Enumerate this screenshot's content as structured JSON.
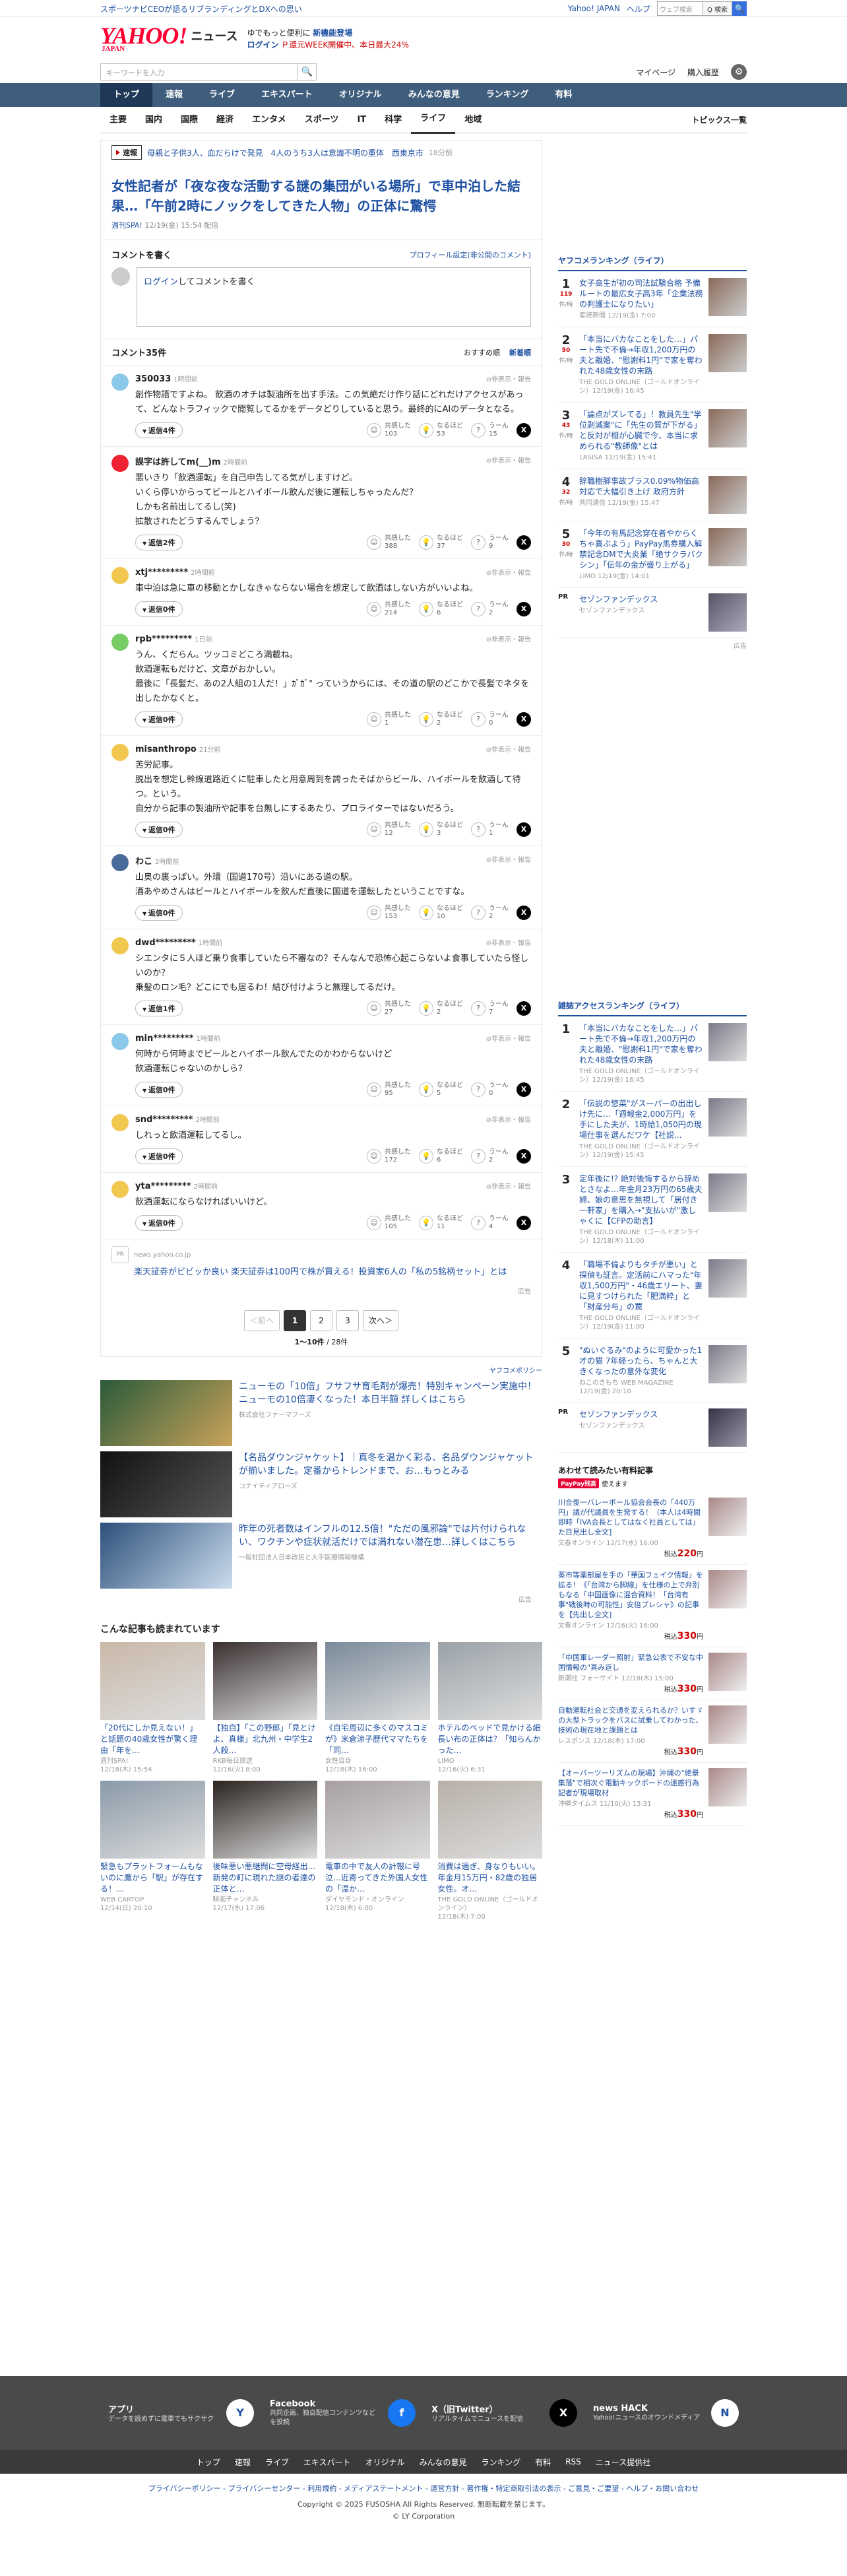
{
  "promo": {
    "text": "スポーツナビCEOが語るリブランディングとDXへの思い"
  },
  "toplinks": {
    "yahoo": "Yahoo! JAPAN",
    "help": "ヘルプ",
    "search_placeholder": "ウェブ検索",
    "search_btn": "Q 検索",
    "search_go": "🔍"
  },
  "header": {
    "logo": "YAHOO!",
    "logo_sub": "JAPAN",
    "title": "ニュース",
    "info1": "ゆでもっと便利に",
    "info1b": "新機能登場",
    "info2": "ログイン",
    "info3": "Ｐ還元WEEK開催中、本日最大24%"
  },
  "search": {
    "placeholder": "キーワードを入力",
    "btn": "🔍",
    "links": [
      "マイページ",
      "購入履歴"
    ],
    "gear": "⚙"
  },
  "gnav": [
    "トップ",
    "速報",
    "ライブ",
    "エキスパート",
    "オリジナル",
    "みんなの意見",
    "ランキング",
    "有料"
  ],
  "subnav": [
    "主要",
    "国内",
    "国際",
    "経済",
    "エンタメ",
    "スポーツ",
    "IT",
    "科学",
    "ライフ",
    "地域"
  ],
  "subnav_right": "トピックス一覧",
  "breaking": {
    "tag": "速報",
    "text": "母親と子供3人、血だらけで発見　4人のうち3人は意識不明の重体　西東京市",
    "time": "18分前"
  },
  "article": {
    "title": "女性記者が「夜な夜な活動する謎の集団がいる場所」で車中泊した結果…「午前2時にノックをしてきた人物」の正体に驚愕",
    "source": "週刊SPA!",
    "date": "12/19(金) 15:54 配信"
  },
  "write": {
    "head": "コメントを書く",
    "profile": "プロフィール設定(非公開のコメント)",
    "login": "ログイン",
    "placeholder": "してコメントを書く"
  },
  "comments_head": {
    "count": "コメント35件",
    "sort1": "おすすめ順",
    "sort2": "新着順"
  },
  "comments": [
    {
      "name": "350033",
      "time": "1時間前",
      "text": "創作物語ですよね。 飲酒のオチは製油所を出す手法。この気絶だけ作り話にどれだけアクセスがあって、どんなトラフィックで閲覧してるかをデータどりしていると思う。最終的にAIのデータとなる。",
      "reply": "返信4件",
      "r1": "共感した",
      "n1": "103",
      "r2": "なるほど",
      "n2": "53",
      "r3": "うーん",
      "n3": "15",
      "color": "#8cc8e8"
    },
    {
      "name": "誤字は許してm(__)m",
      "time": "2時間前",
      "text": "悪いきり「飲酒運転」を自己申告してる気がしますけど。\nいくら停いからってビールとハイボール飲んだ後に運転しちゃったんだ？\nしかも名前出してるし(笑)\n拡散されたどうするんでしょう？",
      "reply": "返信2件",
      "r1": "共感した",
      "n1": "388",
      "r2": "なるほど",
      "n2": "37",
      "r3": "うーん",
      "n3": "9",
      "color": "#e23"
    },
    {
      "name": "xtj*********",
      "time": "2時間前",
      "text": "車中泊は急に車の移動とかしなきゃならない場合を想定して飲酒はしない方がいいよね。",
      "reply": "返信0件",
      "r1": "共感した",
      "n1": "214",
      "r2": "なるほど",
      "n2": "6",
      "r3": "うーん",
      "n3": "2",
      "color": "#f0c850"
    },
    {
      "name": "rpb*********",
      "time": "1日前",
      "text": "うん、くだらん。ツッコミどころ満載ね。\n飲酒運転もだけど、文章がおかしい。\n最後に「長髪だ、あの2人組の1人だ！」ｶﾞｶﾞ\" っていうからには、その道の駅のどこかで長髪でネタを出したかなくと。",
      "reply": "返信0件",
      "r1": "共感した",
      "n1": "1",
      "r2": "なるほど",
      "n2": "2",
      "r3": "うーん",
      "n3": "0",
      "color": "#7c6"
    },
    {
      "name": "misanthropo",
      "time": "21分前",
      "text": "苦労記事。\n脱出を想定し幹線道路近くに駐車したと用意周到を誇ったそばからビール、ハイボールを飲酒して待つ。という。\n自分から記事の製油所や記事を台無しにするあたり、プロライターではないだろう。",
      "reply": "返信0件",
      "r1": "共感した",
      "n1": "12",
      "r2": "なるほど",
      "n2": "3",
      "r3": "うーん",
      "n3": "1",
      "color": "#f0c850"
    },
    {
      "name": "わこ",
      "time": "2時間前",
      "text": "山奥の裏っぱい。外環（国道170号）沿いにある道の駅。\n酒あやめさんはビールとハイボールを飲んだ直後に国道を運転したということですな。",
      "reply": "返信0件",
      "r1": "共感した",
      "n1": "153",
      "r2": "なるほど",
      "n2": "10",
      "r3": "うーん",
      "n3": "2",
      "color": "#4a6a9a"
    },
    {
      "name": "dwd*********",
      "time": "1時間前",
      "text": "シエンタに５人ほど乗り食事していたら不審なの？そんなんで恐怖心起こらないよ食事していたら怪しいのか？\n乗髪のロン毛？どこにでも居るわ！結び付けようと無理してるだけ。",
      "reply": "返信1件",
      "r1": "共感した",
      "n1": "27",
      "r2": "なるほど",
      "n2": "2",
      "r3": "うーん",
      "n3": "7",
      "color": "#f0c850"
    },
    {
      "name": "min*********",
      "time": "1時間前",
      "text": "何時から何時までビールとハイボール飲んでたのかわからないけど\n飲酒運転じゃないのかしら？",
      "reply": "返信0件",
      "r1": "共感した",
      "n1": "95",
      "r2": "なるほど",
      "n2": "5",
      "r3": "うーん",
      "n3": "0",
      "color": "#8cc8e8"
    },
    {
      "name": "snd*********",
      "time": "2時間前",
      "text": "しれっと飲酒運転してるし。",
      "reply": "返信0件",
      "r1": "共感した",
      "n1": "172",
      "r2": "なるほど",
      "n2": "6",
      "r3": "うーん",
      "n3": "2",
      "color": "#f0c850"
    },
    {
      "name": "yta*********",
      "time": "2時間前",
      "text": "飲酒運転にならなければいいけど。",
      "reply": "返信0件",
      "r1": "共感した",
      "n1": "105",
      "r2": "なるほど",
      "n2": "11",
      "r3": "うーん",
      "n3": "4",
      "color": "#f0c850"
    }
  ],
  "flag": "非表示・報告",
  "promo_card": {
    "src": "news.yahoo.co.jp",
    "text": "楽天証券がビビッか良い 楽天証券は100円で株が買える！投資家6人の「私の5銘柄セット」とは",
    "ad": "広告"
  },
  "pager": {
    "prev": "＜前へ",
    "pages": [
      "1",
      "2",
      "3"
    ],
    "next": "次へ＞",
    "count_a": "1〜10件",
    "count_b": " / 28件"
  },
  "policy": "ヤフコメポリシー",
  "ads": [
    {
      "title": "ニューモの「10倍」フサフサ育毛剤が爆売！特別キャンペーン実施中！ニューモの10倍凄くなった！本日半額 詳しくはこちら",
      "src": "株式会社ファーマフーズ"
    },
    {
      "title": "【名品ダウンジャケット】｜真冬を温かく彩る、名品ダウンジャケットが揃いました。定番からトレンドまで、お…もっとみる",
      "src": "コナイティアローズ"
    },
    {
      "title": "昨年の死者数はインフルの12.5倍！\"ただの風邪論\"では片付けられない、ワクチンや症状就活だけでは満れない潜在患…詳しくはこちら",
      "src": "一般社団法人日本改民と大手医療情報機構"
    }
  ],
  "reads_head": "こんな記事も読まれています",
  "reads": [
    {
      "t": "「20代にしか見えない！」と話題の40歳女性が驚く理由「年を…",
      "s": "週刊SPA!",
      "d": "12/18(木) 15:54"
    },
    {
      "t": "【独自】「この野郎」「見とけよ、真様」北九州・中学生2人殺…",
      "s": "RKB毎日放送",
      "d": "12/16(火) 8:00"
    },
    {
      "t": "《自宅周辺に多くのマスコミが》米倉涼子歴代ママたちを「同…",
      "s": "女性自身",
      "d": "12/18(木) 16:00"
    },
    {
      "t": "ホテルのベッドで見かける細長い布の正体は？「知らんかった…",
      "s": "LIMO",
      "d": "12/16(火) 6:31"
    },
    {
      "t": "緊急もプラットフォームもないのに鷹から「駅」が存在する！…",
      "s": "WEB CARTOP",
      "d": "12/14(日) 20:10"
    },
    {
      "t": "後味悪い悪継問に空母経出…新発の町に現れた謎の者達の正体と…",
      "s": "映画チャンネル",
      "d": "12/17(水) 17:06"
    },
    {
      "t": "電車の中で友人の計報に号泣…近寄ってきた外国人女性の「温か…",
      "s": "ダイヤモンド・オンライン",
      "d": "12/18(木) 6:00"
    },
    {
      "t": "消費は過ぎ、身なりもいい。年金月15万円・82歳の独居女性。オ…",
      "s": "THE GOLD ONLINE（ゴールドオンライン）",
      "d": "12/18(木) 7:00"
    }
  ],
  "side_rank1": {
    "head": "ヤフコメランキング（ライフ）",
    "items": [
      {
        "n": "1",
        "c": "119",
        "u": "件/時",
        "t": "女子高生が初の司法試験合格 予備ルートの最広女子高3年「企業法務の判護士になりたい」",
        "s": "産経新聞 12/19(金) 7:00"
      },
      {
        "n": "2",
        "c": "50",
        "u": "件/時",
        "t": "「本当にバカなことをした…」パート先で不倫→年収1,200万円の夫と離婚、\"慰謝料1円\"で家を奪われた48歳女性の末路",
        "s": "THE GOLD ONLINE（ゴールドオンライン）12/19(金) 16:45"
      },
      {
        "n": "3",
        "c": "43",
        "u": "件/時",
        "t": "「論点がズレてる」！教員先生\"学位剥減案\"に「先生の質が下がる」と反対が相が心臓で今、本当に求められる\"教師像\"とは",
        "s": "LASISA 12/19(金) 15:41"
      },
      {
        "n": "4",
        "c": "32",
        "u": "件/時",
        "t": "辞職樹脚事故ブラス0.09%物価高対応で大幅引き上げ 政府方針",
        "s": "共同通信 12/19(金) 15:47"
      },
      {
        "n": "5",
        "c": "30",
        "u": "件/時",
        "t": "「今年の有馬記念穿在者やからくちゃ喜ぶよう」PayPay馬券購入解禁記念DMで大炎業「絶サクラバクシン」「伝年の金が盛り上がる」",
        "s": "LIMO 12/19(金) 14:01"
      }
    ]
  },
  "pr1": {
    "lbl": "PR",
    "t": "セゾンファンデックス",
    "s": "セゾンファンデックス",
    "ad": "広告"
  },
  "side_rank2": {
    "head": "雑誌アクセスランキング（ライフ）",
    "items": [
      {
        "n": "1",
        "t": "「本当にバカなことをした…」パート先で不倫→年収1,200万円の夫と離婚、\"慰謝料1円\"で家を奪われた48歳女性の末路",
        "s": "THE GOLD ONLINE（ゴールドオンライン）12/19(金) 16:45"
      },
      {
        "n": "2",
        "t": "「伝説の惣菜\"がスーパーの出出しけ先に…「週報金2,000万円」を手にした夫が、1時給1,050円の現場仕事を選んだワケ【社説...",
        "s": "THE GOLD ONLINE（ゴールドオンライン）12/19(金) 15:45"
      },
      {
        "n": "3",
        "t": "定年後に!? 絶対後悔するから辞めとさなよ…年金月23万円の65歳夫婦、娘の意思を無視して「居付き一軒家」を購入→\"支払いが\"激しゃくに【CFPの助言】",
        "s": "THE GOLD ONLINE（ゴールドオンライン）12/18(木) 11:00"
      },
      {
        "n": "4",
        "t": "「職場不倫よりもタチが悪い」と探偵も証言。定活前にハマった\"年収1,500万円\"・46歳エリート、妻に見すつけられた「肥満粋」と「財産分与」の罠",
        "s": "THE GOLD ONLINE（ゴールドオンライン）12/19(金) 11:00"
      },
      {
        "n": "5",
        "t": "\"ぬいぐるみ\"のように可愛かった1才の猫 7年経ったら、ちゃんと大きくなったの意外な変化",
        "s": "ねこのきもち WEB MAGAZINE 12/19(金) 20:10"
      }
    ]
  },
  "pr2": {
    "lbl": "PR",
    "t": "セゾンファンデックス",
    "s": "セゾンファンデックス"
  },
  "shop": {
    "head": "あわせて読みたい有料記事",
    "paypay": "PayPay残高",
    "sub": "使えます",
    "items": [
      {
        "t": "川合俊一バレーボール協会会長の「440万円」議が代議員を生発する！（本人は4時間即時「IVA会長としてはなく社員としては」た目見出し全文]",
        "s": "文春オンライン 12/17(水) 16:00",
        "p": "220"
      },
      {
        "t": "蒸市等薬部屋を手の「華国フェイク情報」を拡る！《「台湾から脚線」を仕様の上で弁別もなる「中国画像に混合資料！「台湾有事\"戦後時の可能性」安倍プレシャ》の記事を【先出し全文]",
        "s": "文春オンライン 12/16(火) 16:00",
        "p": "330"
      },
      {
        "t": "「中国軍レーダー照射」緊急公表で不安な中国情報の\"真み返し",
        "s": "新潮社 フォーサイト 12/18(木) 15:00",
        "p": "330"
      },
      {
        "t": "自動運転社会と交通を変えられるか？いすゞの大型トラックをバスに試乗してわかった、技術の現在地と課題とは",
        "s": "レスポンス 12/18(木) 17:00",
        "p": "330"
      },
      {
        "t": "【オーバーツーリズムの現場】沖縄の\"絶景集落\"で相次ぐ電動キックボードの迷惑行為 記者が現場取材",
        "s": "沖縄タイムス 11/10(火) 13:31",
        "p": "330"
      }
    ]
  },
  "price_prefix": "税込",
  "price_suffix": "円",
  "footer": {
    "cells": [
      {
        "n": "アプリ",
        "d": "データを読めずに電車でもサクサク"
      },
      {
        "n": "Facebook",
        "d": "共同企画、独自配信コンテンツなどを投稿"
      },
      {
        "n": "X（旧Twitter）",
        "d": "リアルタイムでニュースを配信"
      },
      {
        "n": "news HACK",
        "d": "Yahoo!ニュースのオウンドメディア"
      }
    ],
    "nav": [
      "トップ",
      "速報",
      "ライブ",
      "エキスパート",
      "オリジナル",
      "みんなの意見",
      "ランキング",
      "有料",
      "RSS",
      "ニュース提供社"
    ],
    "links": "プライバシーポリシー - プライバシーセンター - 利用規約 - メディアステートメント - 運営方針 - 著作権・特定商取引法の表示 - ご意見・ご要望 - ヘルプ・お問い合わせ",
    "copy1": "Copyright © 2025 FUSOSHA All Rights Reserved. 無断転載を禁じます。",
    "copy2": "© LY Corporation"
  },
  "colors": {
    "link": "#1e50a2",
    "nav": "#3f5d7c",
    "brand": "#ff0033"
  }
}
